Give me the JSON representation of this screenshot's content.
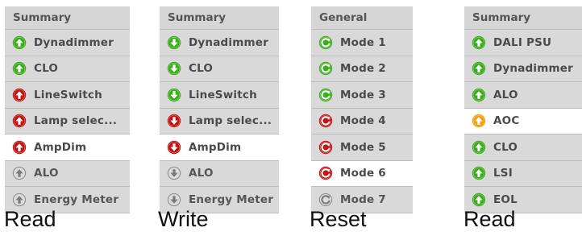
{
  "colors": {
    "green": "#3cab1c",
    "red": "#c41111",
    "orange": "#f0a010",
    "grey": "#b0b0b0",
    "panel": "#d6d6d6",
    "selected": "#ffffff"
  },
  "panels": [
    {
      "header": "Summary",
      "caption": "Read",
      "rows": [
        {
          "label": "Dynadimmer",
          "icon": "up-arrow-icon",
          "color": "green",
          "selected": false
        },
        {
          "label": "CLO",
          "icon": "up-arrow-icon",
          "color": "green",
          "selected": false
        },
        {
          "label": "LineSwitch",
          "icon": "up-arrow-icon",
          "color": "red",
          "selected": false
        },
        {
          "label": "Lamp selec...",
          "icon": "up-arrow-icon",
          "color": "red",
          "selected": false
        },
        {
          "label": "AmpDim",
          "icon": "up-arrow-icon",
          "color": "red",
          "selected": true
        },
        {
          "label": "ALO",
          "icon": "up-arrow-icon",
          "color": "grey",
          "selected": false
        },
        {
          "label": "Energy Meter",
          "icon": "up-arrow-icon",
          "color": "grey",
          "selected": false
        }
      ]
    },
    {
      "header": "Summary",
      "caption": "Write",
      "rows": [
        {
          "label": "Dynadimmer",
          "icon": "down-arrow-icon",
          "color": "green",
          "selected": false
        },
        {
          "label": "CLO",
          "icon": "down-arrow-icon",
          "color": "green",
          "selected": false
        },
        {
          "label": "LineSwitch",
          "icon": "down-arrow-icon",
          "color": "green",
          "selected": false
        },
        {
          "label": "Lamp selec...",
          "icon": "down-arrow-icon",
          "color": "red",
          "selected": false
        },
        {
          "label": "AmpDim",
          "icon": "down-arrow-icon",
          "color": "red",
          "selected": true
        },
        {
          "label": "ALO",
          "icon": "down-arrow-icon",
          "color": "grey",
          "selected": false
        },
        {
          "label": "Energy Meter",
          "icon": "down-arrow-icon",
          "color": "grey",
          "selected": false
        }
      ]
    },
    {
      "header": "General",
      "caption": "Reset",
      "rows": [
        {
          "label": "Mode 1",
          "icon": "reset-icon",
          "color": "green",
          "selected": false
        },
        {
          "label": "Mode 2",
          "icon": "reset-icon",
          "color": "green",
          "selected": false
        },
        {
          "label": "Mode 3",
          "icon": "reset-icon",
          "color": "green",
          "selected": false
        },
        {
          "label": "Mode 4",
          "icon": "reset-icon",
          "color": "red",
          "selected": false
        },
        {
          "label": "Mode 5",
          "icon": "reset-icon",
          "color": "red",
          "selected": false
        },
        {
          "label": "Mode 6",
          "icon": "reset-icon",
          "color": "red",
          "selected": true
        },
        {
          "label": "Mode 7",
          "icon": "reset-icon",
          "color": "grey",
          "selected": false
        }
      ]
    },
    {
      "header": "Summary",
      "caption": "Read",
      "rows": [
        {
          "label": "DALI PSU",
          "icon": "up-arrow-icon",
          "color": "green",
          "selected": false
        },
        {
          "label": "Dynadimmer",
          "icon": "up-arrow-icon",
          "color": "green",
          "selected": false
        },
        {
          "label": "ALO",
          "icon": "up-arrow-icon",
          "color": "green",
          "selected": false
        },
        {
          "label": "AOC",
          "icon": "up-arrow-icon",
          "color": "orange",
          "selected": true
        },
        {
          "label": "CLO",
          "icon": "up-arrow-icon",
          "color": "green",
          "selected": false
        },
        {
          "label": "LSI",
          "icon": "up-arrow-icon",
          "color": "green",
          "selected": false
        },
        {
          "label": "EOL",
          "icon": "up-arrow-icon",
          "color": "green",
          "selected": false
        }
      ]
    }
  ]
}
